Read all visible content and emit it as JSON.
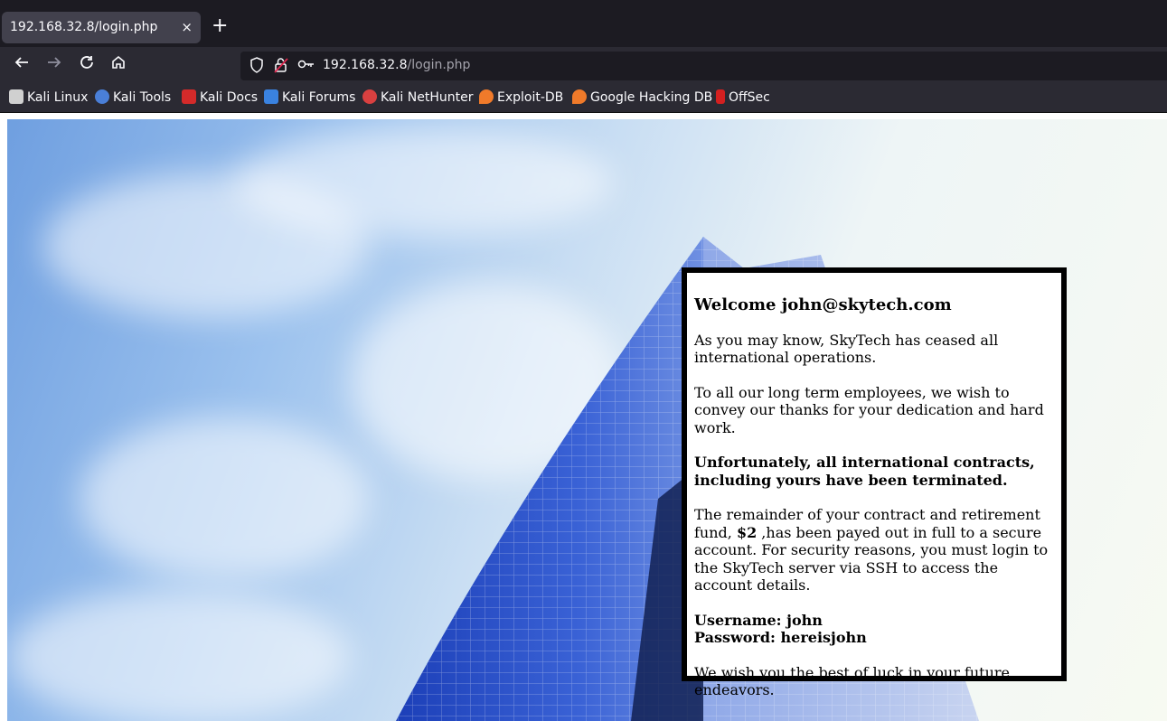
{
  "browser": {
    "tab": {
      "title": "192.168.32.8/login.php",
      "close": "×"
    },
    "new_tab": "+",
    "url": {
      "host": "192.168.32.8",
      "path": "/login.php"
    },
    "bookmarks": [
      {
        "label": "Kali Linux",
        "icon": "kali-dragon-icon",
        "color": "#e0e0e0"
      },
      {
        "label": "Kali Tools",
        "icon": "kali-tools-icon",
        "color": "#4a7fd8"
      },
      {
        "label": "Kali Docs",
        "icon": "kali-docs-icon",
        "color": "#d42a2a"
      },
      {
        "label": "Kali Forums",
        "icon": "kali-forums-icon",
        "color": "#3a82e0"
      },
      {
        "label": "Kali NetHunter",
        "icon": "nethunter-icon",
        "color": "#d94040"
      },
      {
        "label": "Exploit-DB",
        "icon": "exploit-db-icon",
        "color": "#f07a2a"
      },
      {
        "label": "Google Hacking DB",
        "icon": "ghdb-icon",
        "color": "#f07a2a"
      },
      {
        "label": "OffSec",
        "icon": "offsec-icon",
        "color": "#d42020"
      }
    ]
  },
  "page": {
    "title": "Welcome john@skytech.com",
    "p1": "As you may know, SkyTech has ceased all international operations.",
    "p2": "To all our long term employees, we wish to convey our thanks for your dedication and hard work.",
    "p3": "Unfortunately, all international contracts, including yours have been terminated.",
    "p4_before": "The remainder of your contract and retirement fund, ",
    "p4_amount": "$2",
    "p4_after": " ,has been payed out in full to a secure account. For security reasons, you must login to the SkyTech server via SSH to access the account details.",
    "username_label": "Username: john",
    "password_label": "Password: hereisjohn",
    "p5": "We wish you the best of luck in your future endeavors."
  }
}
